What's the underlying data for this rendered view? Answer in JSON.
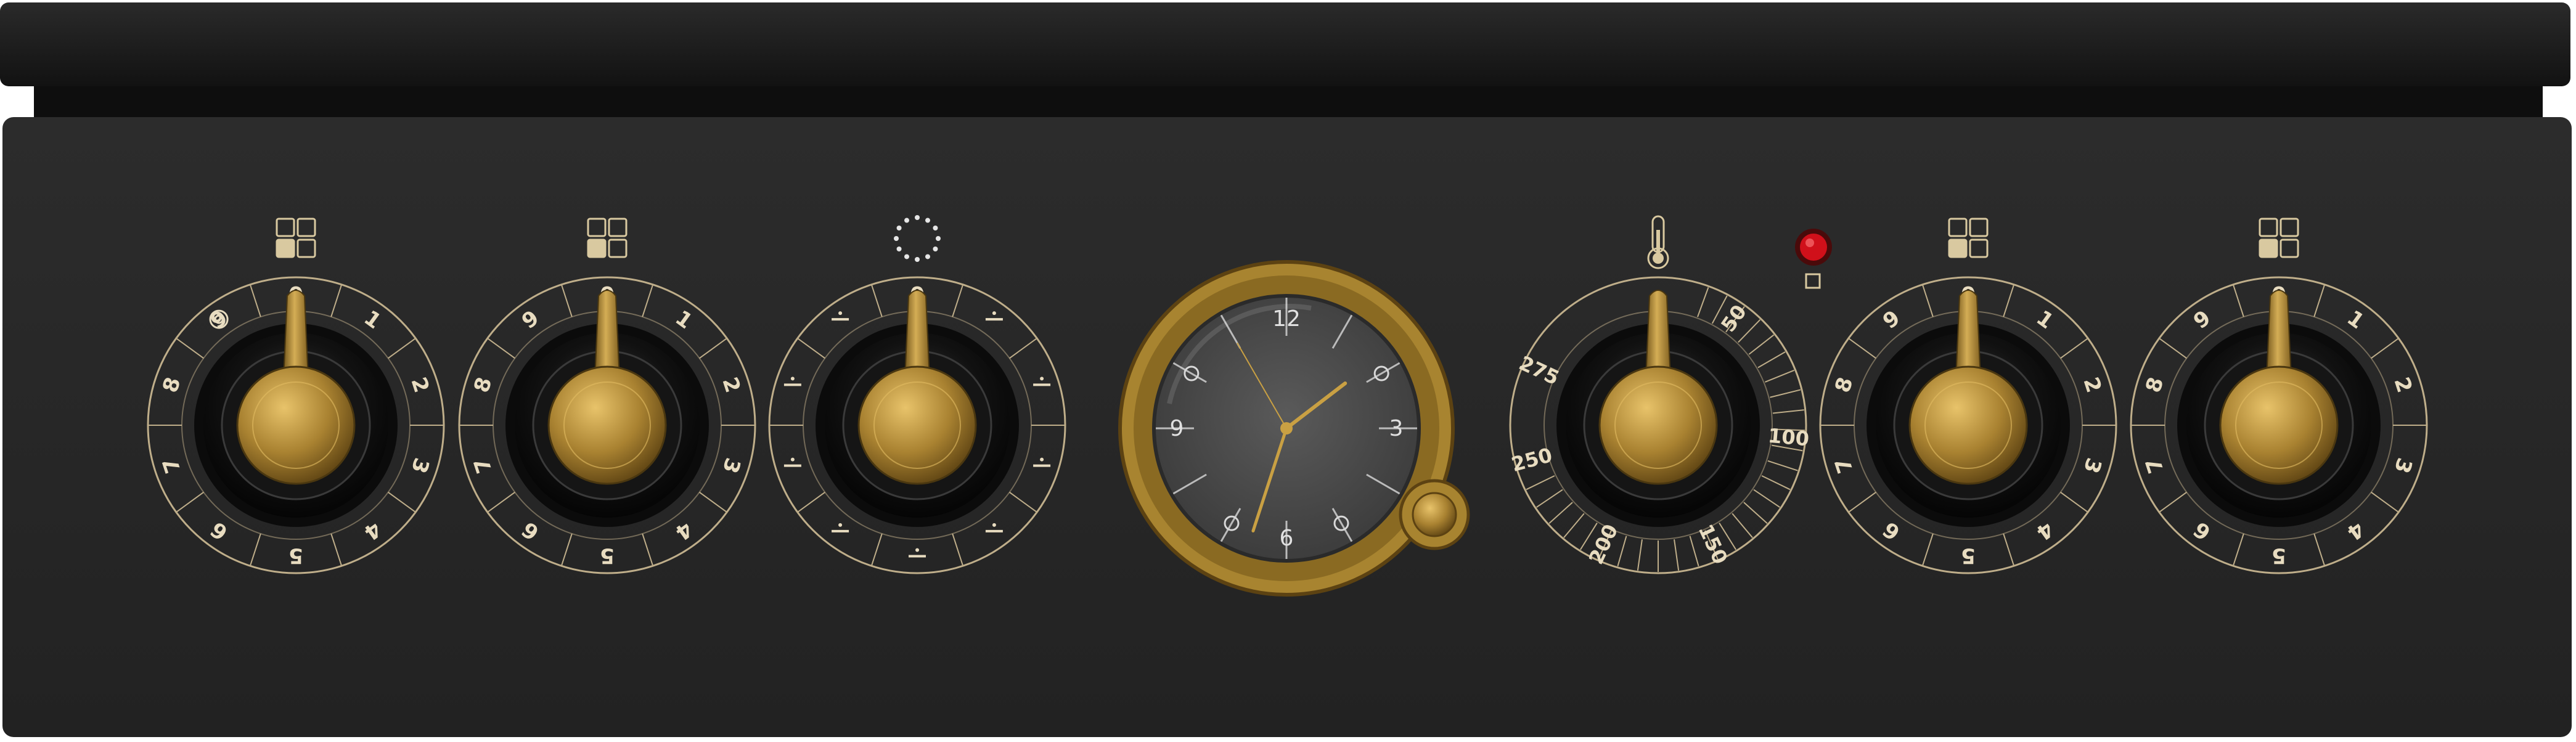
{
  "colors": {
    "body": "#262626",
    "lid": "#1c1c1c",
    "gold": "#c9a043",
    "gold_dark": "#7a5a18",
    "scale_line": "#bfae8a",
    "indicator_light": "#d0101a",
    "clock_face": "#4a4a4a"
  },
  "knobs": [
    {
      "id": "hob-knob-1",
      "symbol": "hotplate-zones-icon",
      "labels": [
        "0",
        "9",
        "8",
        "7",
        "6",
        "5",
        "4",
        "3",
        "2",
        "1"
      ],
      "extra_icon": "ring-icon"
    },
    {
      "id": "hob-knob-2",
      "symbol": "hotplate-zones-icon",
      "labels": [
        "0",
        "1",
        "2",
        "3",
        "4",
        "5",
        "6",
        "7",
        "8",
        "9"
      ]
    },
    {
      "id": "oven-function-knob",
      "symbol": "dotted-circle-icon",
      "labels": [
        "0"
      ]
    },
    {
      "id": "temperature-knob",
      "symbol": "thermometer-icon",
      "labels": [
        "50",
        "100",
        "150",
        "200",
        "250",
        "275"
      ]
    },
    {
      "id": "hob-knob-3",
      "symbol": "hotplate-zones-icon",
      "labels": [
        "0",
        "1",
        "2",
        "3",
        "4",
        "5",
        "6",
        "7",
        "8",
        "9"
      ]
    },
    {
      "id": "hob-knob-4",
      "symbol": "hotplate-zones-icon",
      "labels": [
        "0",
        "1",
        "2",
        "3",
        "4",
        "5",
        "6",
        "7",
        "8",
        "9"
      ]
    }
  ],
  "clock": {
    "numerals": {
      "top": "12",
      "right": "3",
      "bottom": "6",
      "left": "9"
    },
    "hour": 1.2,
    "minute": 33
  },
  "indicator": {
    "state": "on"
  }
}
